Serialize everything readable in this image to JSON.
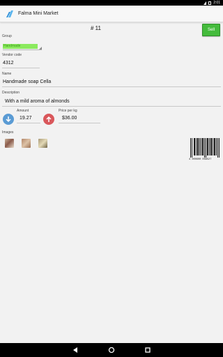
{
  "status_bar": {
    "time": "2:01",
    "icons": [
      "cloud-icon",
      "wifi-icon",
      "battery-icon"
    ]
  },
  "app": {
    "title": "Falma Mini Market",
    "logo_icon": "app-logo-icon",
    "accent_color": "#44bb3c"
  },
  "record": {
    "number": "# 11",
    "sell_label": "Sell"
  },
  "fields": {
    "group_label": "Group",
    "group_value": "Handmade",
    "vendor_code_label": "Vendor code",
    "vendor_code_value": "4312",
    "name_label": "Name",
    "name_value": "Handmade soap Cella",
    "description_label": "Description",
    "description_value": "With a mild aroma of almonds",
    "amount_label": "Amount",
    "amount_value": "19.27",
    "price_label": "Price per kg",
    "price_value": "$36.00"
  },
  "images": {
    "label": "Images",
    "items": [
      "product-image-1",
      "product-image-2",
      "product-image-3"
    ]
  },
  "barcode": {
    "digits": "4 000600 009527"
  },
  "nav": {
    "icons": [
      "back-icon",
      "home-icon",
      "recents-icon"
    ]
  }
}
